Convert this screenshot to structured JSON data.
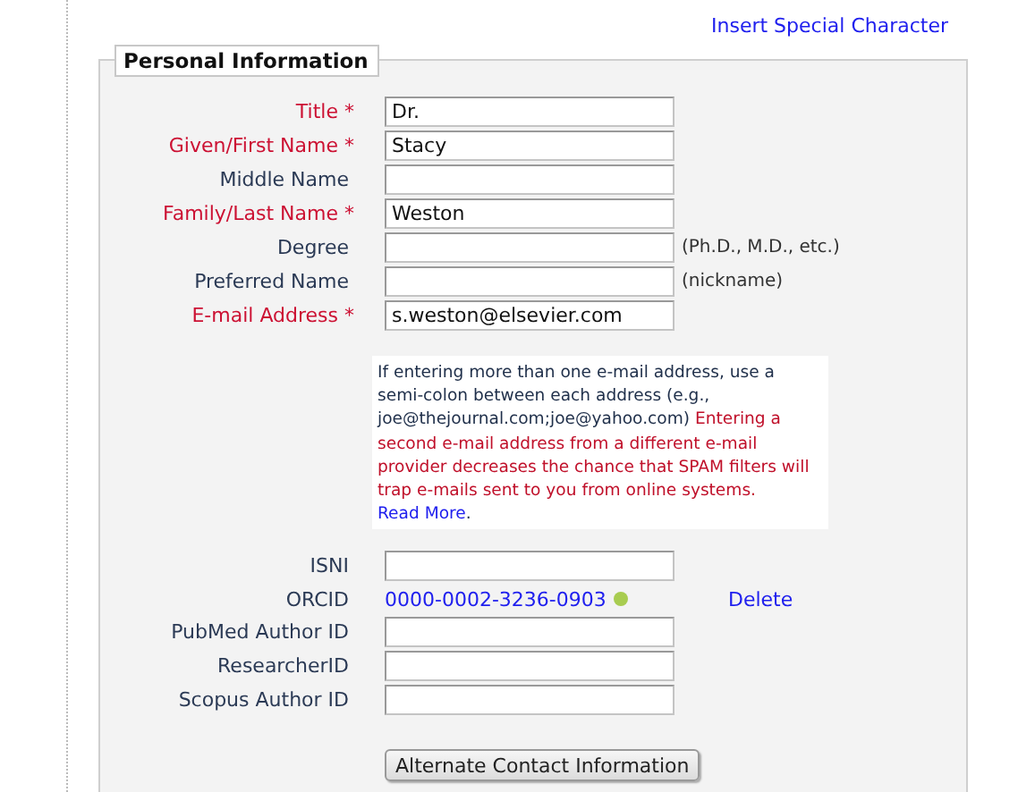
{
  "header_link": "Insert Special Character",
  "section": {
    "legend": "Personal Information",
    "fields": [
      {
        "kind": "input",
        "label": "Title *",
        "required": true,
        "value": "Dr."
      },
      {
        "kind": "input",
        "label": "Given/First Name *",
        "required": true,
        "value": "Stacy"
      },
      {
        "kind": "input",
        "label": "Middle Name",
        "required": false
      },
      {
        "kind": "input",
        "label": "Family/Last Name *",
        "required": true,
        "value": "Weston"
      },
      {
        "kind": "input",
        "label": "Degree",
        "required": false,
        "hint": "(Ph.D., M.D., etc.)"
      },
      {
        "kind": "input",
        "label": "Preferred Name",
        "required": false,
        "hint": "(nickname)"
      },
      {
        "kind": "input",
        "label": "E-mail Address *",
        "required": true,
        "value": "s.weston@elsevier.com"
      },
      {
        "kind": "note",
        "text": "If entering more than one e-mail address, use a semi-colon between each address (e.g., joe@thejournal.com;joe@yahoo.com)",
        "warning": "Entering a second e-mail address from a different e-mail provider decreases the chance that SPAM filters will trap e-mails sent to you from online systems.",
        "link": "Read More",
        "end": "."
      },
      {
        "kind": "input",
        "label": "ISNI",
        "required": false
      },
      {
        "kind": "link",
        "label": "ORCID",
        "required": false,
        "value": "0000-0002-3236-0903",
        "color": "#a8cc50",
        "action": "Delete"
      },
      {
        "kind": "input",
        "label": "PubMed Author ID",
        "required": false
      },
      {
        "kind": "input",
        "label": "ResearcherID",
        "required": false
      },
      {
        "kind": "input",
        "label": "Scopus Author ID",
        "required": false
      }
    ],
    "button": "Alternate Contact Information"
  }
}
